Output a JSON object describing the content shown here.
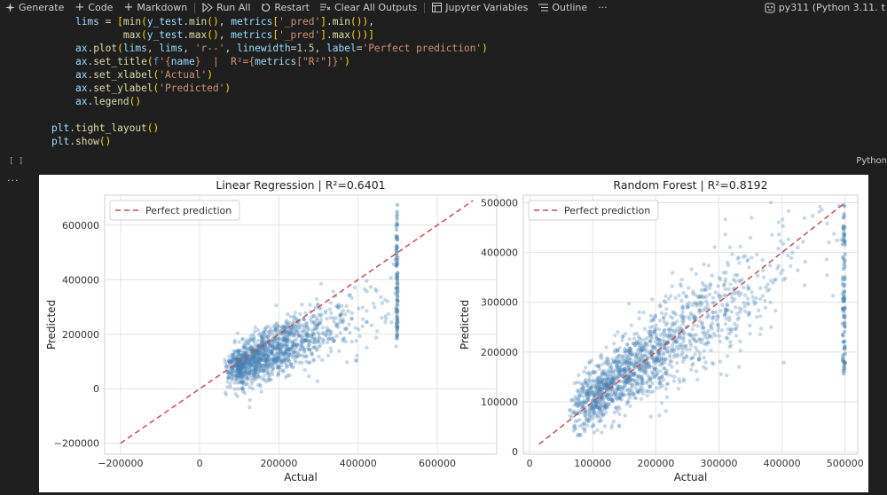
{
  "toolbar": {
    "generate": "Generate",
    "code": "Code",
    "markdown": "Markdown",
    "run_all": "Run All",
    "restart": "Restart",
    "clear_all": "Clear All Outputs",
    "jupyter_vars": "Jupyter Variables",
    "outline": "Outline",
    "more": "···",
    "kernel": "py311 (Python 3.11.",
    "kernel_suffix": "t"
  },
  "cell": {
    "exec_count": "[ ]",
    "language": "Python",
    "output_more": "···",
    "code_lines": [
      "    lims = [min(y_test.min(), metrics['_pred'].min()),",
      "            max(y_test.max(), metrics['_pred'].max())]",
      "    ax.plot(lims, lims, 'r--', linewidth=1.5, label='Perfect prediction')",
      "    ax.set_title(f'{name}  |  R²={metrics[\"R²\"]}')",
      "    ax.set_xlabel('Actual')",
      "    ax.set_ylabel('Predicted')",
      "    ax.legend()",
      "",
      "plt.tight_layout()",
      "plt.show()"
    ]
  },
  "colors": {
    "point": "#4682b4",
    "diag": "#c44e52"
  },
  "chart_data": [
    {
      "type": "scatter",
      "title": "Linear Regression  |  R²=0.6401",
      "xlabel": "Actual",
      "ylabel": "Predicted",
      "xlim": [
        -240000,
        750000
      ],
      "ylim": [
        -240000,
        710000
      ],
      "xticks": [
        -200000,
        0,
        200000,
        400000,
        600000
      ],
      "yticks": [
        -200000,
        0,
        200000,
        400000,
        600000
      ],
      "xtick_labels": [
        "−200000",
        "0",
        "200000",
        "400000",
        "600000"
      ],
      "ytick_labels": [
        "−200000",
        "0",
        "200000",
        "400000",
        "600000"
      ],
      "grid": true,
      "legend": "upper left",
      "series": [
        {
          "name": "Perfect prediction",
          "kind": "dashed-line",
          "x": [
            -200000,
            690000
          ],
          "y": [
            -200000,
            690000
          ]
        }
      ],
      "points_summary": "dense cloud rising from (15000, 0) to (500000, 300000); vertical band at 500001 spanning about 180000 to 680000"
    },
    {
      "type": "scatter",
      "title": "Random Forest  |  R²=0.8192",
      "xlabel": "Actual",
      "ylabel": "Predicted",
      "xlim": [
        -10000,
        520000
      ],
      "ylim": [
        -5000,
        515000
      ],
      "xticks": [
        0,
        100000,
        200000,
        300000,
        400000,
        500000
      ],
      "yticks": [
        0,
        100000,
        200000,
        300000,
        400000,
        500000
      ],
      "xtick_labels": [
        "0",
        "100000",
        "200000",
        "300000",
        "400000",
        "500000"
      ],
      "ytick_labels": [
        "0",
        "100000",
        "200000",
        "300000",
        "400000",
        "500000"
      ],
      "grid": true,
      "legend": "upper left",
      "series": [
        {
          "name": "Perfect prediction",
          "kind": "dashed-line",
          "x": [
            15000,
            500001
          ],
          "y": [
            15000,
            500001
          ]
        }
      ],
      "points_summary": "tight cloud along diagonal from (15000, 50000) to (500000, 480000); vertical band at 500001 spanning about 150000 to 500000"
    }
  ]
}
